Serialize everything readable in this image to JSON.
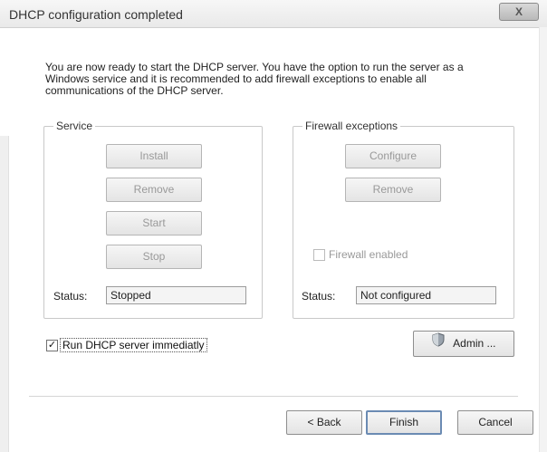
{
  "window": {
    "title": "DHCP configuration completed",
    "close_glyph": "X"
  },
  "intro": "You are now ready to start the DHCP server. You have the option to run the server as a Windows service and it is recommended to add firewall exceptions to enable all communications of the DHCP server.",
  "service": {
    "label": "Service",
    "buttons": {
      "install": "Install",
      "remove": "Remove",
      "start": "Start",
      "stop": "Stop"
    },
    "status_label": "Status:",
    "status_value": "Stopped"
  },
  "firewall": {
    "label": "Firewall exceptions",
    "buttons": {
      "configure": "Configure",
      "remove": "Remove"
    },
    "checkbox_label": "Firewall enabled",
    "status_label": "Status:",
    "status_value": "Not configured"
  },
  "run_checkbox": {
    "label": "Run DHCP server immediatly",
    "checked": true,
    "mark": "✓"
  },
  "admin_button": "Admin ...",
  "footer": {
    "back": "< Back",
    "finish": "Finish",
    "cancel": "Cancel"
  }
}
